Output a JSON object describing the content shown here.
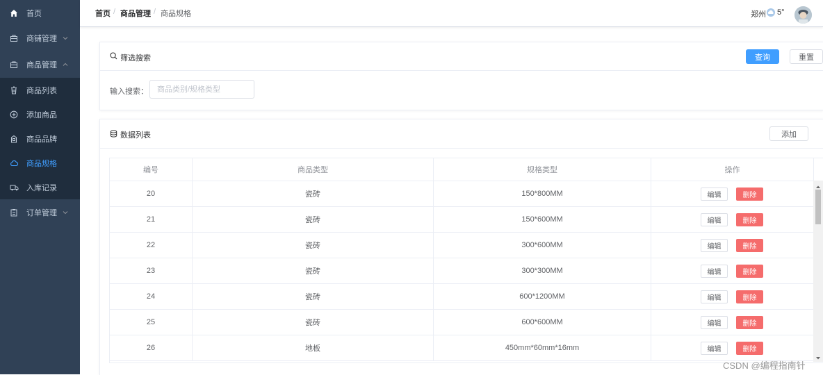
{
  "sidebar": {
    "items": [
      {
        "label": "首页",
        "icon": "home-icon"
      },
      {
        "label": "商铺管理",
        "icon": "store-icon"
      },
      {
        "label": "商品管理",
        "icon": "goods-icon"
      },
      {
        "label": "商品列表",
        "icon": "list-icon"
      },
      {
        "label": "添加商品",
        "icon": "plus-circle-icon"
      },
      {
        "label": "商品品牌",
        "icon": "brand-icon"
      },
      {
        "label": "商品规格",
        "icon": "cloud-icon"
      },
      {
        "label": "入库记录",
        "icon": "truck-icon"
      },
      {
        "label": "订单管理",
        "icon": "order-icon"
      }
    ],
    "active_color": "#409eff",
    "bg_color": "#304156",
    "submenu_bg_color": "#1f2d3d"
  },
  "header": {
    "breadcrumb": [
      "首页",
      "商品管理",
      "商品规格"
    ],
    "breadcrumb_sep": "/",
    "city": "郑州",
    "temperature": "5°"
  },
  "filter": {
    "title": "筛选搜索",
    "query_button": "查询",
    "reset_button": "重置",
    "search_label": "输入搜索：",
    "search_placeholder": "商品类别/规格类型",
    "search_value": ""
  },
  "list": {
    "title": "数据列表",
    "add_button": "添加",
    "columns": [
      "编号",
      "商品类型",
      "规格类型",
      "操作"
    ],
    "edit_label": "编辑",
    "delete_label": "删除",
    "rows": [
      {
        "id": "20",
        "type": "瓷砖",
        "spec": "150*800MM"
      },
      {
        "id": "21",
        "type": "瓷砖",
        "spec": "150*600MM"
      },
      {
        "id": "22",
        "type": "瓷砖",
        "spec": "300*600MM"
      },
      {
        "id": "23",
        "type": "瓷砖",
        "spec": "300*300MM"
      },
      {
        "id": "24",
        "type": "瓷砖",
        "spec": "600*1200MM"
      },
      {
        "id": "25",
        "type": "瓷砖",
        "spec": "600*600MM"
      },
      {
        "id": "26",
        "type": "地板",
        "spec": "450mm*60mm*16mm"
      }
    ]
  },
  "watermark": "CSDN @编程指南针",
  "colors": {
    "primary": "#409eff",
    "danger": "#f56c6c"
  }
}
